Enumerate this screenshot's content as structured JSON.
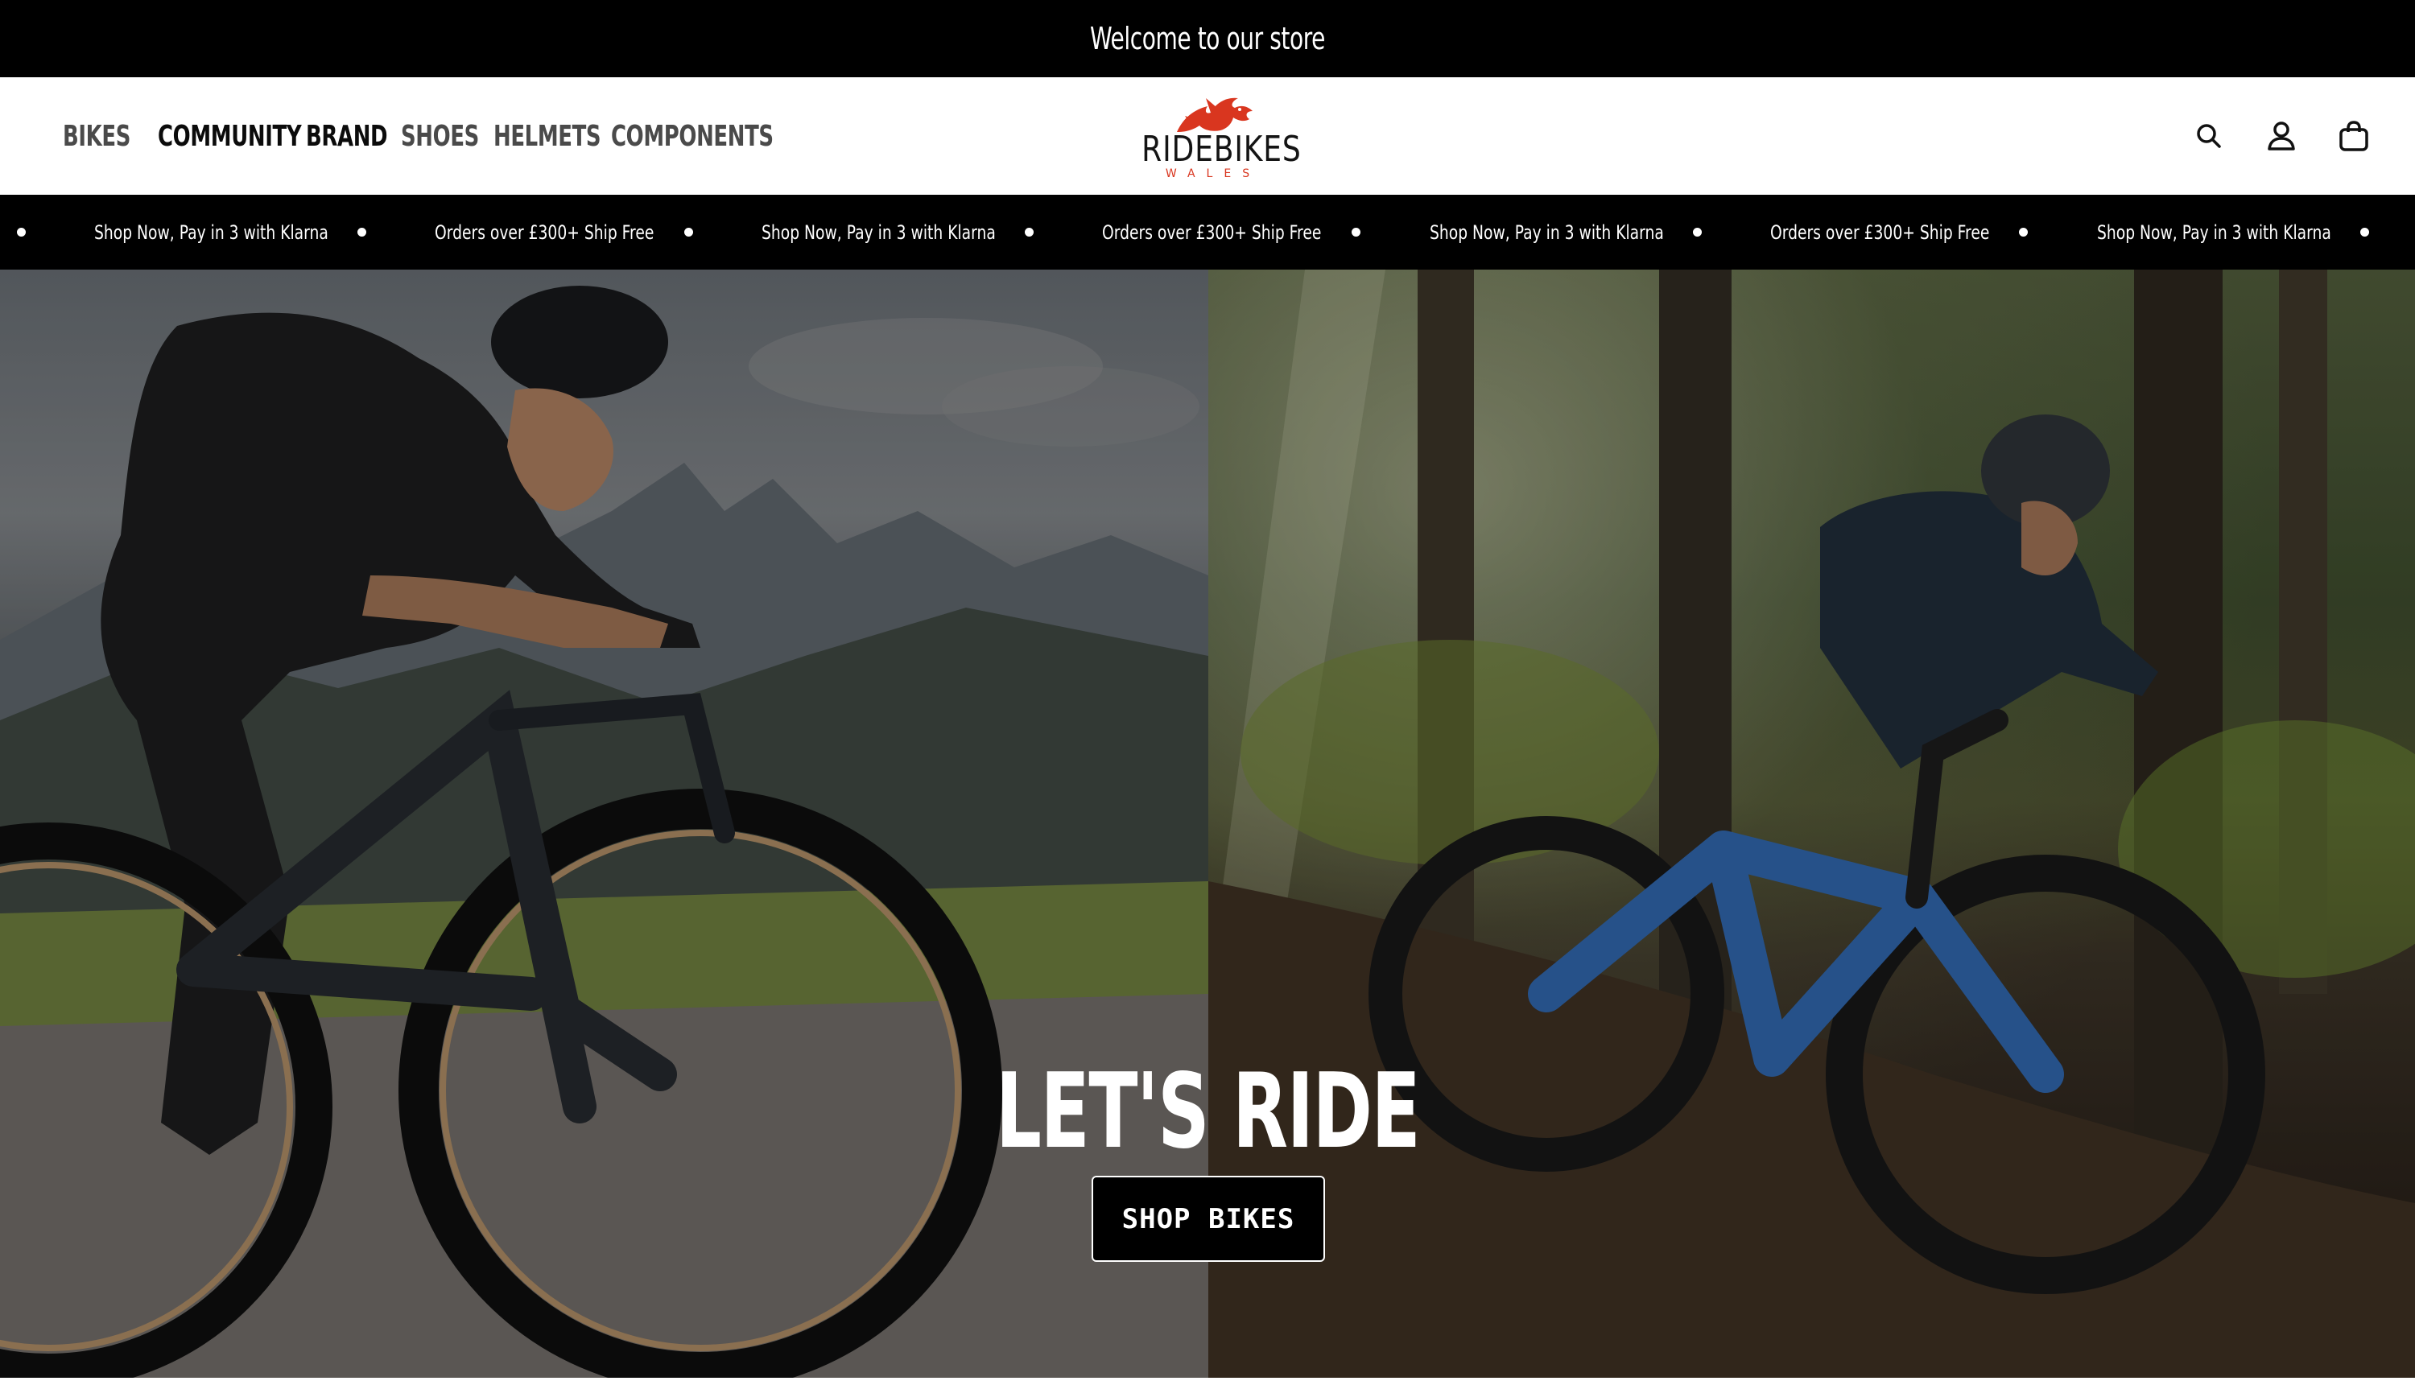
{
  "announcement": {
    "text": "Welcome to our store"
  },
  "nav": {
    "items": [
      {
        "label": "BIKES"
      },
      {
        "label": "COMMUNITY"
      },
      {
        "label": "BRAND"
      },
      {
        "label": "SHOES"
      },
      {
        "label": "HELMETS"
      },
      {
        "label": "COMPONENTS"
      }
    ]
  },
  "logo": {
    "name": "RIDEBIKES",
    "sub": "WALES"
  },
  "header_icons": [
    "search-icon",
    "account-icon",
    "cart-icon"
  ],
  "marquee": {
    "items": [
      "Shop Now, Pay in 3 with Klarna",
      "Orders over £300+ Ship Free",
      "Shop Now, Pay in 3 with Klarna",
      "Orders over £300+ Ship Free",
      "Shop Now, Pay in 3 with Klarna",
      "Orders over £300+ Ship Free",
      "Shop Now, Pay in 3 with Klarna"
    ]
  },
  "hero": {
    "title": "LET'S RIDE",
    "cta_label": "SHOP BIKES"
  },
  "colors": {
    "bar": "#000000",
    "logo_red": "#d9361f",
    "nav_text": "#4a4a4a",
    "nav_text_strong": "#0b0b0b"
  }
}
